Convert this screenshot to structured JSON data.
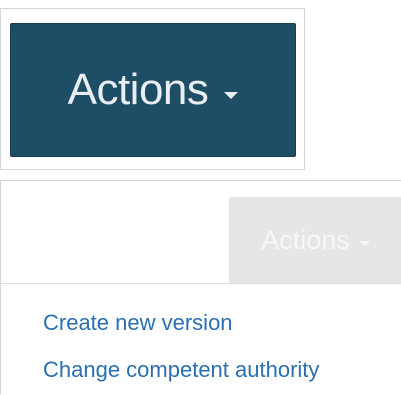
{
  "top_button": {
    "label": "Actions",
    "caret_icon": "caret-down-icon",
    "background": "#1d4e66",
    "text_color": "#e9eef2"
  },
  "bottom_button": {
    "label": "Actions",
    "caret_icon": "caret-down-icon",
    "background": "#e6e6e6"
  },
  "dropdown": {
    "items": [
      {
        "label": "Create new version"
      },
      {
        "label": "Change competent authority"
      }
    ],
    "link_color": "#2a6fb0"
  }
}
